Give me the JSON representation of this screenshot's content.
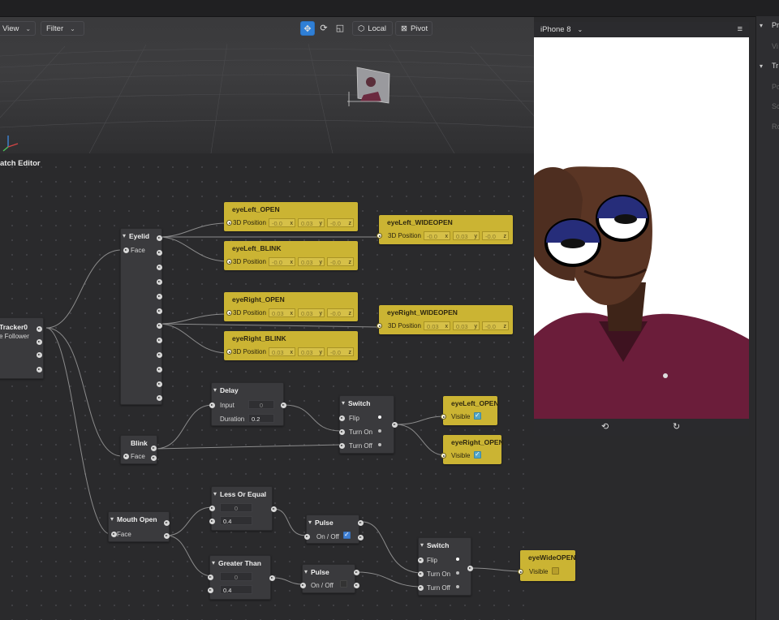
{
  "toolbar": {
    "view_label": "View",
    "filter_label": "Filter",
    "local_label": "Local",
    "pivot_label": "Pivot"
  },
  "patch_editor": {
    "title": "atch Editor"
  },
  "simulator": {
    "device": "iPhone 8"
  },
  "right_panel": {
    "items": [
      "Pr",
      "Vi",
      "Tr",
      "Po",
      "Sc",
      "Ro"
    ]
  },
  "nodes": {
    "facetracker": {
      "title": "Tracker0",
      "sub": "e Follower"
    },
    "eyelid": {
      "title": "Eyelid",
      "port": "Face"
    },
    "blink": {
      "title": "Blink",
      "port": "Face"
    },
    "mouth": {
      "title": "Mouth Open",
      "port": "Face"
    },
    "eyeLeft_OPEN": {
      "title": "eyeLeft_OPEN",
      "label": "3D Position",
      "x": "-0.0",
      "y": "0.03",
      "z": "-0.0"
    },
    "eyeLeft_BLINK": {
      "title": "eyeLeft_BLINK",
      "label": "3D Position",
      "x": "-0.0",
      "y": "0.03",
      "z": "-0.0"
    },
    "eyeLeft_WIDEOPEN": {
      "title": "eyeLeft_WIDEOPEN",
      "label": "3D Position",
      "x": "-0.0",
      "y": "0.03",
      "z": "-0.0"
    },
    "eyeRight_OPEN": {
      "title": "eyeRight_OPEN",
      "label": "3D Position",
      "x": "0.03",
      "y": "0.03",
      "z": "-0.0"
    },
    "eyeRight_BLINK": {
      "title": "eyeRight_BLINK",
      "label": "3D Position",
      "x": "0.03",
      "y": "0.03",
      "z": "-0.0"
    },
    "eyeRight_WIDEOPEN": {
      "title": "eyeRight_WIDEOPEN",
      "label": "3D Position",
      "x": "0.03",
      "y": "0.03",
      "z": "-0.0"
    },
    "delay": {
      "title": "Delay",
      "input_label": "Input",
      "input_value": "0",
      "duration_label": "Duration",
      "duration_value": "0.2"
    },
    "switch1": {
      "title": "Switch",
      "flip": "Flip",
      "turn_on": "Turn On",
      "turn_off": "Turn Off"
    },
    "vis_left": {
      "title": "eyeLeft_OPEN",
      "label": "Visible",
      "checked": true
    },
    "vis_right": {
      "title": "eyeRight_OPEN",
      "label": "Visible",
      "checked": true
    },
    "less_or_equal": {
      "title": "Less Or Equal",
      "a": "0",
      "b": "0.4"
    },
    "greater_than": {
      "title": "Greater Than",
      "a": "0",
      "b": "0.4"
    },
    "pulse1": {
      "title": "Pulse",
      "label": "On / Off",
      "checked": true
    },
    "pulse2": {
      "title": "Pulse",
      "label": "On / Off",
      "checked": false
    },
    "switch2": {
      "title": "Switch",
      "flip": "Flip",
      "turn_on": "Turn On",
      "turn_off": "Turn Off"
    },
    "vis_wide": {
      "title": "eyeWideOPEN",
      "label": "Visible",
      "checked": false
    }
  },
  "axis_letters": {
    "x": "x",
    "y": "y",
    "z": "z"
  },
  "colors": {
    "patch_yellow": "#cbb433",
    "node_gray": "#3a3a3d",
    "accent_blue": "#2f7fd6",
    "shirt": "#6b1d3a"
  }
}
